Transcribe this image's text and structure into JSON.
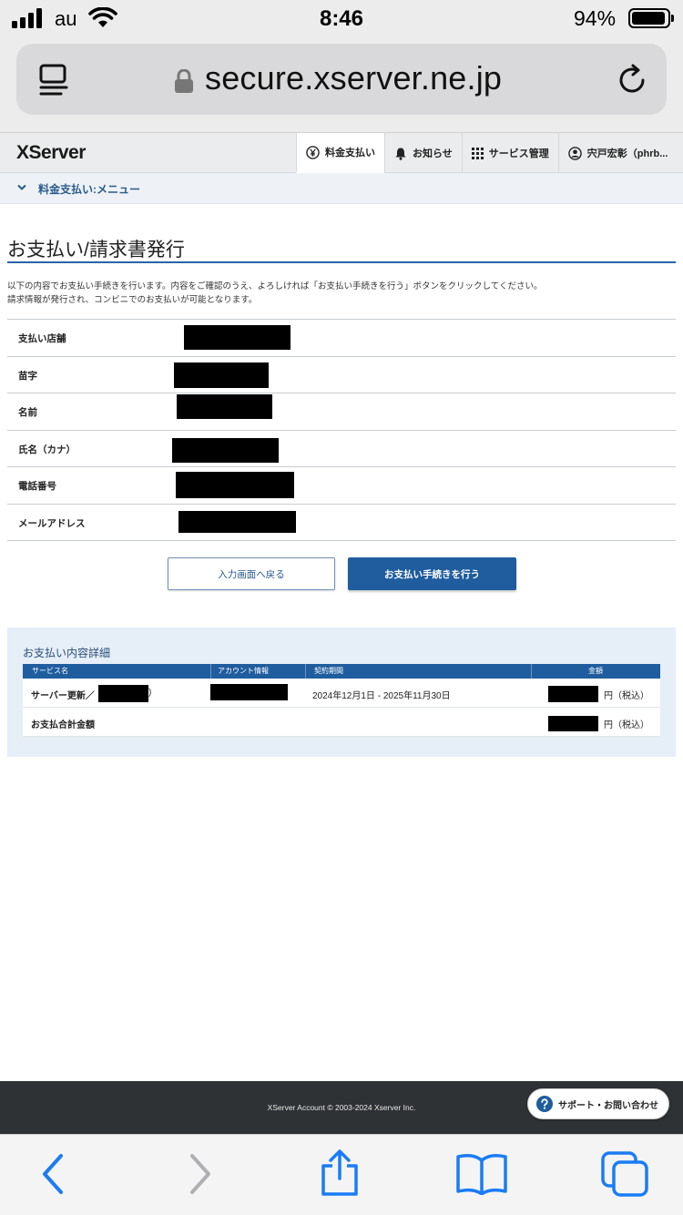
{
  "status_bar": {
    "carrier": "au",
    "time": "8:46",
    "battery": "94%"
  },
  "browser": {
    "url": "secure.xserver.ne.jp"
  },
  "header": {
    "logo": "XServer",
    "nav": [
      {
        "label": "料金支払い",
        "icon": "yen-icon",
        "active": true
      },
      {
        "label": "お知らせ",
        "icon": "bell-icon",
        "active": false
      },
      {
        "label": "サービス管理",
        "icon": "grid-icon",
        "active": false
      },
      {
        "label": "宍戸宏彰（phrb...",
        "icon": "user-icon",
        "active": false
      }
    ]
  },
  "breadcrumb": {
    "label": "料金支払い:メニュー"
  },
  "main": {
    "title": "お支払い/請求書発行",
    "intro_line1": "以下の内容でお支払い手続きを行います。内容をご確認のうえ、よろしければ「お支払い手続きを行う」ボタンをクリックしてください。",
    "intro_line2": "請求情報が発行され、コンビニでのお支払いが可能となります。",
    "fields": [
      {
        "label": "支払い店舗"
      },
      {
        "label": "苗字"
      },
      {
        "label": "名前"
      },
      {
        "label": "氏名（カナ）"
      },
      {
        "label": "電話番号"
      },
      {
        "label": "メールアドレス"
      }
    ],
    "back_button": "入力画面へ戻る",
    "pay_button": "お支払い手続きを行う"
  },
  "details": {
    "title": "お支払い内容詳細",
    "headers": {
      "service": "サービス名",
      "account": "アカウント情報",
      "period": "契約期間",
      "amount": "金額"
    },
    "row": {
      "service_prefix": "サーバー更新／",
      "service_suffix": ")",
      "period": "2024年12月1日 - 2025年11月30日",
      "amount_suffix": "円（税込）"
    },
    "total": {
      "label": "お支払合計金額",
      "amount_suffix": "円（税込）"
    }
  },
  "footer": {
    "copyright": "XServer Account © 2003-2024 Xserver Inc.",
    "support": "サポート・お問い合わせ"
  },
  "colors": {
    "accent": "#1f5d9e",
    "title_rule": "#2a64a8",
    "footer_bg": "#2f3235",
    "ios_blue": "#1a7cf5"
  }
}
